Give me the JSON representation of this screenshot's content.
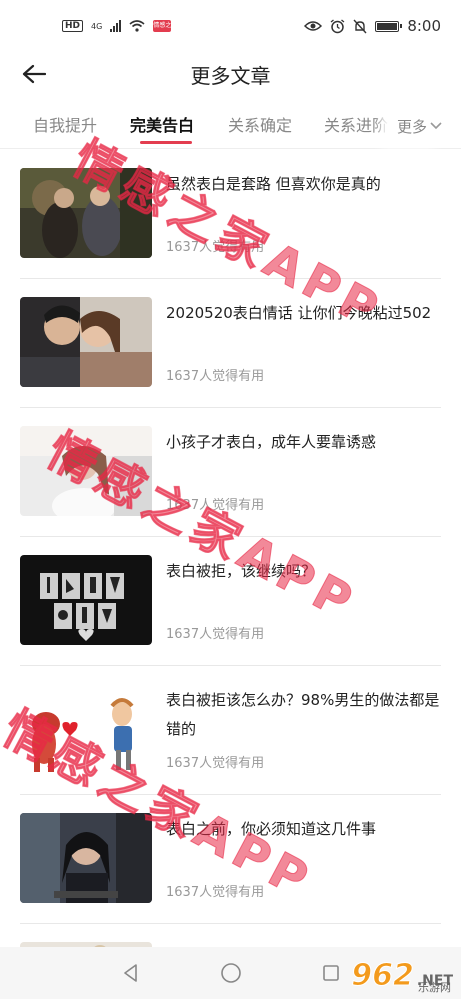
{
  "status_bar": {
    "left_badge": "HD",
    "network": "4G",
    "app_badge": "情感之家",
    "time": "8:00"
  },
  "header": {
    "title": "更多文章"
  },
  "tabs": [
    {
      "label": "自我提升"
    },
    {
      "label": "完美告白"
    },
    {
      "label": "关系确定"
    },
    {
      "label": "关系进阶"
    }
  ],
  "more_label": "更多",
  "articles": [
    {
      "title": "虽然表白是套路 但喜欢你是真的",
      "meta": "1637人觉得有用"
    },
    {
      "title": "2020520表白情话 让你们今晚粘过502",
      "meta": "1637人觉得有用"
    },
    {
      "title": "小孩子才表白，成年人要靠诱惑",
      "meta": "1637人觉得有用"
    },
    {
      "title": "表白被拒，该继续吗？",
      "meta": "1637人觉得有用"
    },
    {
      "title": "表白被拒该怎么办？98%男生的做法都是错的",
      "meta": "1637人觉得有用"
    },
    {
      "title": "表白之前，你必须知道这几件事",
      "meta": "1637人觉得有用"
    }
  ],
  "watermark_text": "情感之家APP",
  "site_logo": {
    "num": "962",
    "net": ".NET",
    "sub": "乐游网"
  },
  "colors": {
    "accent": "#e33d4f",
    "watermark": "#e82846"
  }
}
